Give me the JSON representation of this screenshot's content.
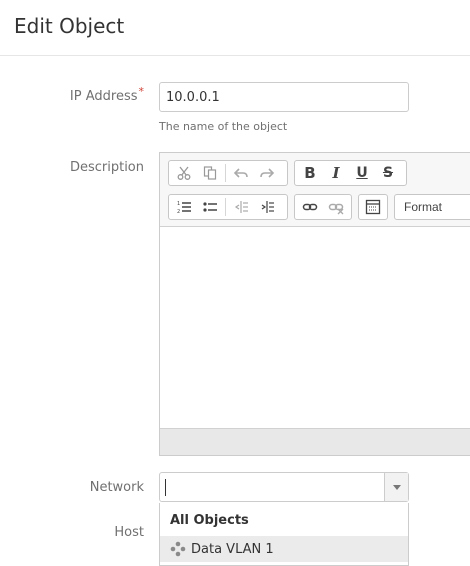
{
  "page": {
    "title": "Edit Object"
  },
  "form": {
    "ip_address": {
      "label": "IP Address",
      "required_marker": "*",
      "value": "10.0.0.1",
      "hint": "The name of the object"
    },
    "description": {
      "label": "Description",
      "toolbar": {
        "bold": "B",
        "italic": "I",
        "underline": "U",
        "strike": "S",
        "format_label": "Format"
      }
    },
    "network": {
      "label": "Network",
      "value": "",
      "dropdown": {
        "group_header": "All Objects",
        "items": [
          {
            "label": "Data VLAN 1",
            "icon": "network-object-icon"
          }
        ]
      }
    },
    "host": {
      "label": "Host"
    }
  },
  "colors": {
    "required": "#d04437",
    "highlight": "#ebebeb",
    "border": "#cccccc"
  }
}
